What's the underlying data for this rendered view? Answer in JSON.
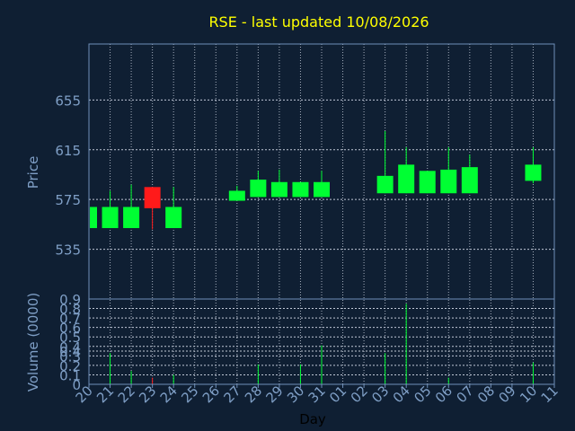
{
  "chart_data": {
    "type": "candlestick",
    "title": "RSE - last updated 10/08/2026",
    "xlabel": "Day",
    "categories": [
      "20",
      "21",
      "22",
      "23",
      "24",
      "25",
      "26",
      "27",
      "28",
      "29",
      "30",
      "31",
      "01",
      "02",
      "03",
      "04",
      "05",
      "06",
      "07",
      "08",
      "09",
      "10",
      "11"
    ],
    "price": {
      "ylabel": "Price",
      "ylim": [
        495,
        700
      ],
      "ticks": [
        535,
        575,
        615,
        655
      ],
      "grid": true,
      "candles": [
        {
          "x": "20",
          "open": 552,
          "close": 569,
          "high": 569,
          "low": 552,
          "dir": "up"
        },
        {
          "x": "21",
          "open": 552,
          "close": 569,
          "high": 582,
          "low": 552,
          "dir": "up"
        },
        {
          "x": "22",
          "open": 552,
          "close": 569,
          "high": 587,
          "low": 552,
          "dir": "up"
        },
        {
          "x": "23",
          "open": 585,
          "close": 568,
          "high": 585,
          "low": 551,
          "dir": "down"
        },
        {
          "x": "24",
          "open": 552,
          "close": 569,
          "high": 585,
          "low": 552,
          "dir": "up"
        },
        {
          "x": "27",
          "open": 574,
          "close": 582,
          "high": 586,
          "low": 574,
          "dir": "up"
        },
        {
          "x": "28",
          "open": 577,
          "close": 591,
          "high": 598,
          "low": 577,
          "dir": "up"
        },
        {
          "x": "29",
          "open": 577,
          "close": 589,
          "high": 599,
          "low": 577,
          "dir": "up"
        },
        {
          "x": "30",
          "open": 577,
          "close": 589,
          "high": 589,
          "low": 577,
          "dir": "up"
        },
        {
          "x": "31",
          "open": 577,
          "close": 589,
          "high": 598,
          "low": 577,
          "dir": "up"
        },
        {
          "x": "03",
          "open": 580,
          "close": 594,
          "high": 630,
          "low": 580,
          "dir": "up"
        },
        {
          "x": "04",
          "open": 580,
          "close": 603,
          "high": 617,
          "low": 580,
          "dir": "up"
        },
        {
          "x": "05",
          "open": 580,
          "close": 598,
          "high": 598,
          "low": 580,
          "dir": "up"
        },
        {
          "x": "06",
          "open": 580,
          "close": 599,
          "high": 617,
          "low": 580,
          "dir": "up"
        },
        {
          "x": "07",
          "open": 580,
          "close": 601,
          "high": 611,
          "low": 580,
          "dir": "up"
        },
        {
          "x": "10",
          "open": 590,
          "close": 603,
          "high": 617,
          "low": 588,
          "dir": "up"
        }
      ]
    },
    "volume": {
      "ylabel": "Volume (0000)",
      "ylim": [
        0,
        0.9
      ],
      "ticks": [
        "0",
        "0.1",
        "0.2",
        "0.3",
        "0.4",
        "0.4",
        "0.5",
        "0.6",
        "0.7",
        "0.8",
        "0.9"
      ],
      "tick_values": [
        0,
        0.1,
        0.2,
        0.3,
        0.35,
        0.4,
        0.5,
        0.6,
        0.7,
        0.8,
        0.9
      ],
      "bars": [
        {
          "x": "21",
          "value": 0.33,
          "dir": "up"
        },
        {
          "x": "22",
          "value": 0.14,
          "dir": "up"
        },
        {
          "x": "23",
          "value": 0.07,
          "dir": "down"
        },
        {
          "x": "24",
          "value": 0.1,
          "dir": "up"
        },
        {
          "x": "28",
          "value": 0.21,
          "dir": "up"
        },
        {
          "x": "30",
          "value": 0.21,
          "dir": "up"
        },
        {
          "x": "31",
          "value": 0.41,
          "dir": "up"
        },
        {
          "x": "03",
          "value": 0.33,
          "dir": "up"
        },
        {
          "x": "04",
          "value": 0.85,
          "dir": "up"
        },
        {
          "x": "06",
          "value": 0.07,
          "dir": "up"
        },
        {
          "x": "10",
          "value": 0.23,
          "dir": "up"
        }
      ]
    },
    "colors": {
      "background": "#0f1f33",
      "title": "#ffff00",
      "axis_text": "#7f9fc6",
      "frame": "#6f8fb8",
      "grid": "#c0c8d6",
      "up": "#00ff33",
      "down": "#ff1a1a"
    }
  }
}
